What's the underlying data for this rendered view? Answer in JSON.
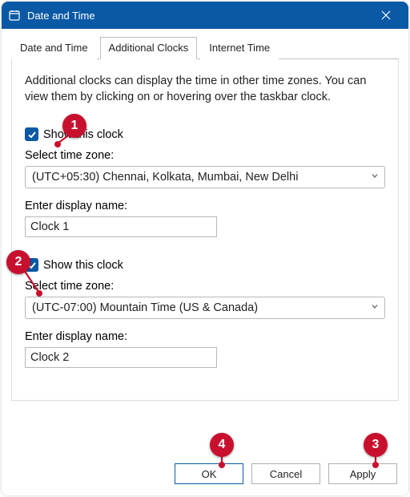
{
  "window": {
    "title": "Date and Time",
    "titlebar_color": "#0a59a5"
  },
  "tabs": {
    "items": [
      {
        "label": "Date and Time",
        "active": false
      },
      {
        "label": "Additional Clocks",
        "active": true
      },
      {
        "label": "Internet Time",
        "active": false
      }
    ]
  },
  "panel": {
    "intro": "Additional clocks can display the time in other time zones. You can view them by clicking on or hovering over the taskbar clock.",
    "clocks": [
      {
        "show_label": "Show this clock",
        "show_checked": true,
        "tz_label": "Select time zone:",
        "tz_value": "(UTC+05:30) Chennai, Kolkata, Mumbai, New Delhi",
        "name_label": "Enter display name:",
        "name_value": "Clock 1"
      },
      {
        "show_label": "Show this clock",
        "show_checked": true,
        "tz_label": "Select time zone:",
        "tz_value": "(UTC-07:00) Mountain Time (US & Canada)",
        "name_label": "Enter display name:",
        "name_value": "Clock 2"
      }
    ]
  },
  "buttons": {
    "ok": "OK",
    "cancel": "Cancel",
    "apply": "Apply"
  },
  "annotations": [
    {
      "n": "1"
    },
    {
      "n": "2"
    },
    {
      "n": "3"
    },
    {
      "n": "4"
    }
  ]
}
